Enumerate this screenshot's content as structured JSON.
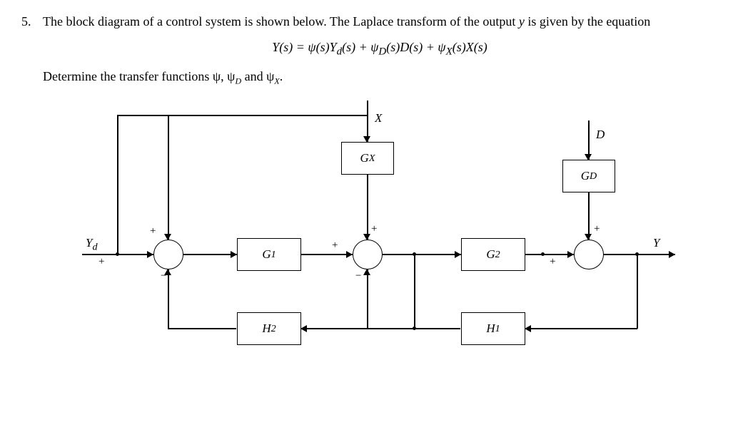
{
  "question_number": "5.",
  "question_text_1": "The block diagram of a control system is shown below. The Laplace transform of the output ",
  "question_text_2": " is given by the equation",
  "variable_y": "y",
  "equation_html": "Y(s) = ψ(s)Y<sub>d</sub>(s) + ψ<sub>D</sub>(s)D(s) + ψ<sub>X</sub>(s)X(s)",
  "question_text_3": "Determine the transfer functions ψ, ψ",
  "question_text_3_sub1": "D",
  "question_text_3_mid": " and ψ",
  "question_text_3_sub2": "X",
  "question_text_3_end": ".",
  "blocks": {
    "GX": "G<sub>X</sub>",
    "GD": "G<sub>D</sub>",
    "G1": "G<sub>1</sub>",
    "G2": "G<sub>2</sub>",
    "H1": "H<sub>1</sub>",
    "H2": "H<sub>2</sub>"
  },
  "signals": {
    "X": "X",
    "D": "D",
    "Yd": "Y<sub>d</sub>",
    "Y": "Y"
  },
  "signs": {
    "plus": "+",
    "minus": "−"
  },
  "chart_data": {
    "type": "block-diagram",
    "inputs": [
      "Yd",
      "X",
      "D"
    ],
    "output": "Y",
    "blocks": [
      "G1",
      "G2",
      "GX",
      "GD",
      "H1",
      "H2"
    ],
    "summing_junctions": [
      {
        "id": "sj1",
        "inputs": [
          {
            "signal": "Yd",
            "sign": "+"
          },
          {
            "signal": "Yd_feedforward",
            "sign": "+"
          },
          {
            "signal": "H2_out",
            "sign": "-"
          }
        ],
        "output": "e1"
      },
      {
        "id": "sj2",
        "inputs": [
          {
            "signal": "G1_out",
            "sign": "+"
          },
          {
            "signal": "GX_out",
            "sign": "+"
          },
          {
            "signal": "H1_out",
            "sign": "-"
          }
        ],
        "output": "e2"
      },
      {
        "id": "sj3",
        "inputs": [
          {
            "signal": "G2_out",
            "sign": "+"
          },
          {
            "signal": "GD_out",
            "sign": "+"
          }
        ],
        "output": "Y"
      }
    ],
    "connections": [
      {
        "from": "Yd",
        "to": "sj1"
      },
      {
        "from": "Yd",
        "to": "sj1",
        "note": "feedforward top path"
      },
      {
        "from": "sj1",
        "to": "G1"
      },
      {
        "from": "G1",
        "to": "sj2"
      },
      {
        "from": "X",
        "to": "GX"
      },
      {
        "from": "GX",
        "to": "sj2"
      },
      {
        "from": "sj2",
        "to": "G2"
      },
      {
        "from": "G2",
        "to": "sj3"
      },
      {
        "from": "D",
        "to": "GD"
      },
      {
        "from": "GD",
        "to": "sj3"
      },
      {
        "from": "sj3",
        "to": "Y"
      },
      {
        "from": "Y",
        "to": "H1"
      },
      {
        "from": "H1",
        "to": "sj2",
        "sign": "-"
      },
      {
        "from": "sj2_out_node",
        "to": "H2"
      },
      {
        "from": "H2",
        "to": "sj1",
        "sign": "-"
      }
    ],
    "output_equation": "Y(s) = psi(s)*Yd(s) + psi_D(s)*D(s) + psi_X(s)*X(s)"
  }
}
